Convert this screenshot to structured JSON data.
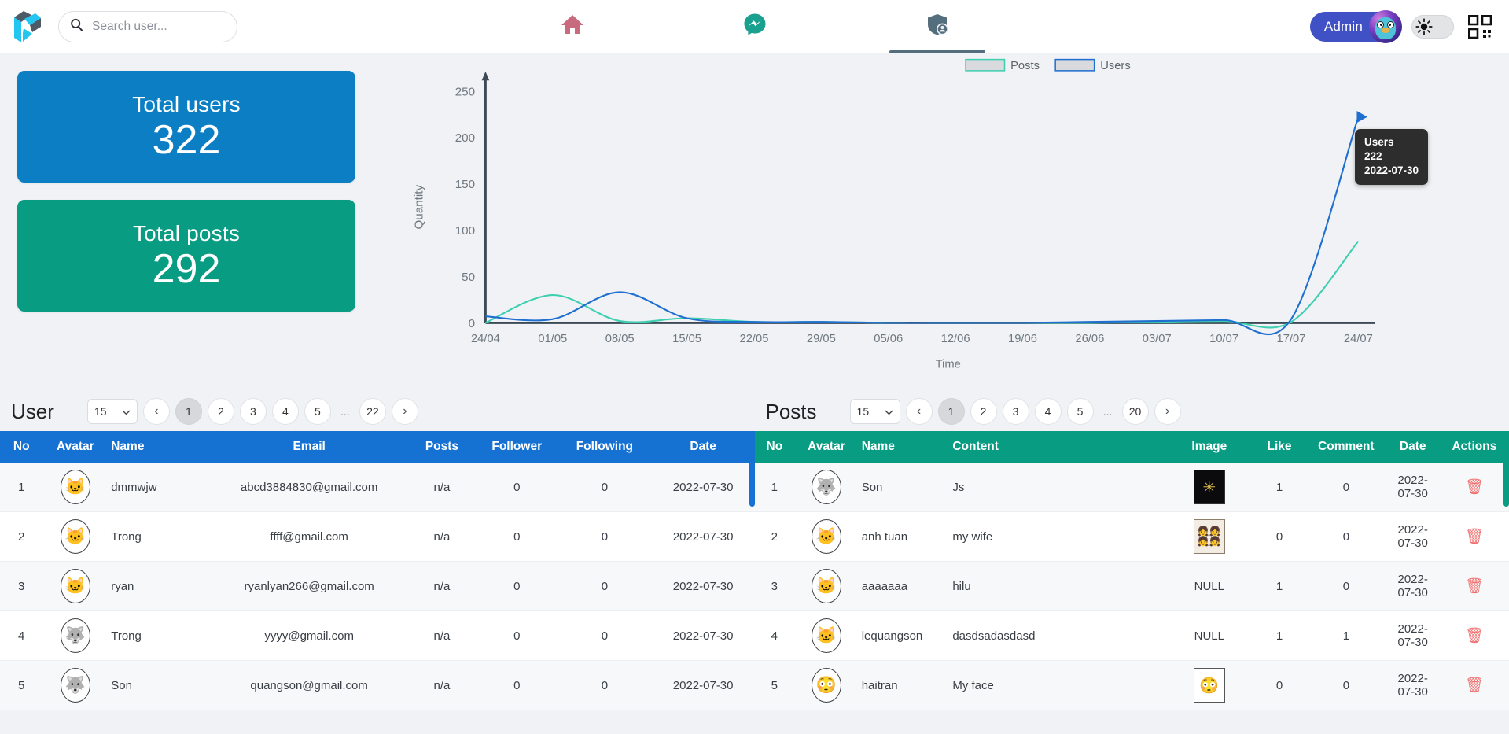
{
  "header": {
    "logo_name": "app-logo",
    "search": {
      "placeholder": "Search user...",
      "value": ""
    },
    "nav": [
      {
        "name": "home",
        "icon": "home-icon",
        "active": false
      },
      {
        "name": "messenger",
        "icon": "messenger-icon",
        "active": false
      },
      {
        "name": "admin",
        "icon": "shield-user-icon",
        "active": true
      }
    ],
    "admin_label": "Admin",
    "theme_icon": "sun-icon",
    "qr_icon": "qr-code-icon",
    "colors": {
      "home": "#c96b7f",
      "messenger": "#1aa08e",
      "admin_tab": "#546e7e",
      "admin_pill": "#3f51c5"
    }
  },
  "cards": [
    {
      "title": "Total users",
      "value": "322",
      "color": "#0c7fc4",
      "name": "total-users-card"
    },
    {
      "title": "Total posts",
      "value": "292",
      "color": "#089c83",
      "name": "total-posts-card"
    }
  ],
  "chart_data": {
    "type": "line",
    "title": "",
    "xlabel": "Time",
    "ylabel": "Quantity",
    "ylim": [
      0,
      250
    ],
    "yticks": [
      0,
      50,
      100,
      150,
      200,
      250
    ],
    "grid": false,
    "legend_position": "top-center",
    "categories": [
      "24/04",
      "01/05",
      "08/05",
      "15/05",
      "22/05",
      "29/05",
      "05/06",
      "12/06",
      "19/06",
      "26/06",
      "03/07",
      "10/07",
      "17/07",
      "24/07"
    ],
    "series": [
      {
        "name": "Posts",
        "color": "#3ecfb0",
        "values": [
          0,
          30,
          2,
          5,
          1,
          1,
          0,
          0,
          0,
          0,
          1,
          2,
          1,
          88
        ]
      },
      {
        "name": "Users",
        "color": "#1f6fd0",
        "values": [
          7,
          4,
          33,
          5,
          1,
          1,
          0,
          0,
          0,
          1,
          2,
          3,
          4,
          222
        ]
      }
    ],
    "tooltip": {
      "series_name": "Users",
      "value": "222",
      "date": "2022-07-30"
    }
  },
  "user_panel": {
    "title": "User",
    "page_size": "15",
    "pages": [
      "1",
      "2",
      "3",
      "4",
      "5",
      "...",
      "22"
    ],
    "active_page": "1",
    "prev_icon": "chevron-left-icon",
    "next_icon": "chevron-right-icon",
    "columns": [
      "No",
      "Avatar",
      "Name",
      "Email",
      "Posts",
      "Follower",
      "Following",
      "Date"
    ],
    "header_color": "#1572d3",
    "rows": [
      {
        "no": "1",
        "avatar": "🐱",
        "name": "dmmwjw",
        "email": "abcd3884830@gmail.com",
        "posts": "n/a",
        "follower": "0",
        "following": "0",
        "date": "2022-07-30"
      },
      {
        "no": "2",
        "avatar": "🐱",
        "name": "Trong",
        "email": "ffff@gmail.com",
        "posts": "n/a",
        "follower": "0",
        "following": "0",
        "date": "2022-07-30"
      },
      {
        "no": "3",
        "avatar": "🐱",
        "name": "ryan",
        "email": "ryanlyan266@gmail.com",
        "posts": "n/a",
        "follower": "0",
        "following": "0",
        "date": "2022-07-30"
      },
      {
        "no": "4",
        "avatar": "🐺",
        "name": "Trong",
        "email": "yyyy@gmail.com",
        "posts": "n/a",
        "follower": "0",
        "following": "0",
        "date": "2022-07-30"
      },
      {
        "no": "5",
        "avatar": "🐺",
        "name": "Son",
        "email": "quangson@gmail.com",
        "posts": "n/a",
        "follower": "0",
        "following": "0",
        "date": "2022-07-30"
      }
    ]
  },
  "posts_panel": {
    "title": "Posts",
    "page_size": "15",
    "pages": [
      "1",
      "2",
      "3",
      "4",
      "5",
      "...",
      "20"
    ],
    "active_page": "1",
    "prev_icon": "chevron-left-icon",
    "next_icon": "chevron-right-icon",
    "columns": [
      "No",
      "Avatar",
      "Name",
      "Content",
      "Image",
      "Like",
      "Comment",
      "Date",
      "Actions"
    ],
    "header_color": "#089c83",
    "delete_icon": "trash-icon",
    "rows": [
      {
        "no": "1",
        "avatar": "🐺",
        "name": "Son",
        "content": "Js",
        "image": "thumb",
        "image_kind": "dark",
        "like": "1",
        "comment": "0",
        "date": "2022-07-30"
      },
      {
        "no": "2",
        "avatar": "🐱",
        "name": "anh tuan",
        "content": "my wife",
        "image": "thumb",
        "image_kind": "wife",
        "like": "0",
        "comment": "0",
        "date": "2022-07-30"
      },
      {
        "no": "3",
        "avatar": "🐱",
        "name": "aaaaaaa",
        "content": "hilu",
        "image": "NULL",
        "image_kind": "null",
        "like": "1",
        "comment": "0",
        "date": "2022-07-30"
      },
      {
        "no": "4",
        "avatar": "🐱",
        "name": "lequangson",
        "content": "dasdsadasdasd",
        "image": "NULL",
        "image_kind": "null",
        "like": "1",
        "comment": "1",
        "date": "2022-07-30"
      },
      {
        "no": "5",
        "avatar": "😳",
        "name": "haitran",
        "content": "My face",
        "image": "thumb",
        "image_kind": "face",
        "like": "0",
        "comment": "0",
        "date": "2022-07-30"
      }
    ]
  }
}
